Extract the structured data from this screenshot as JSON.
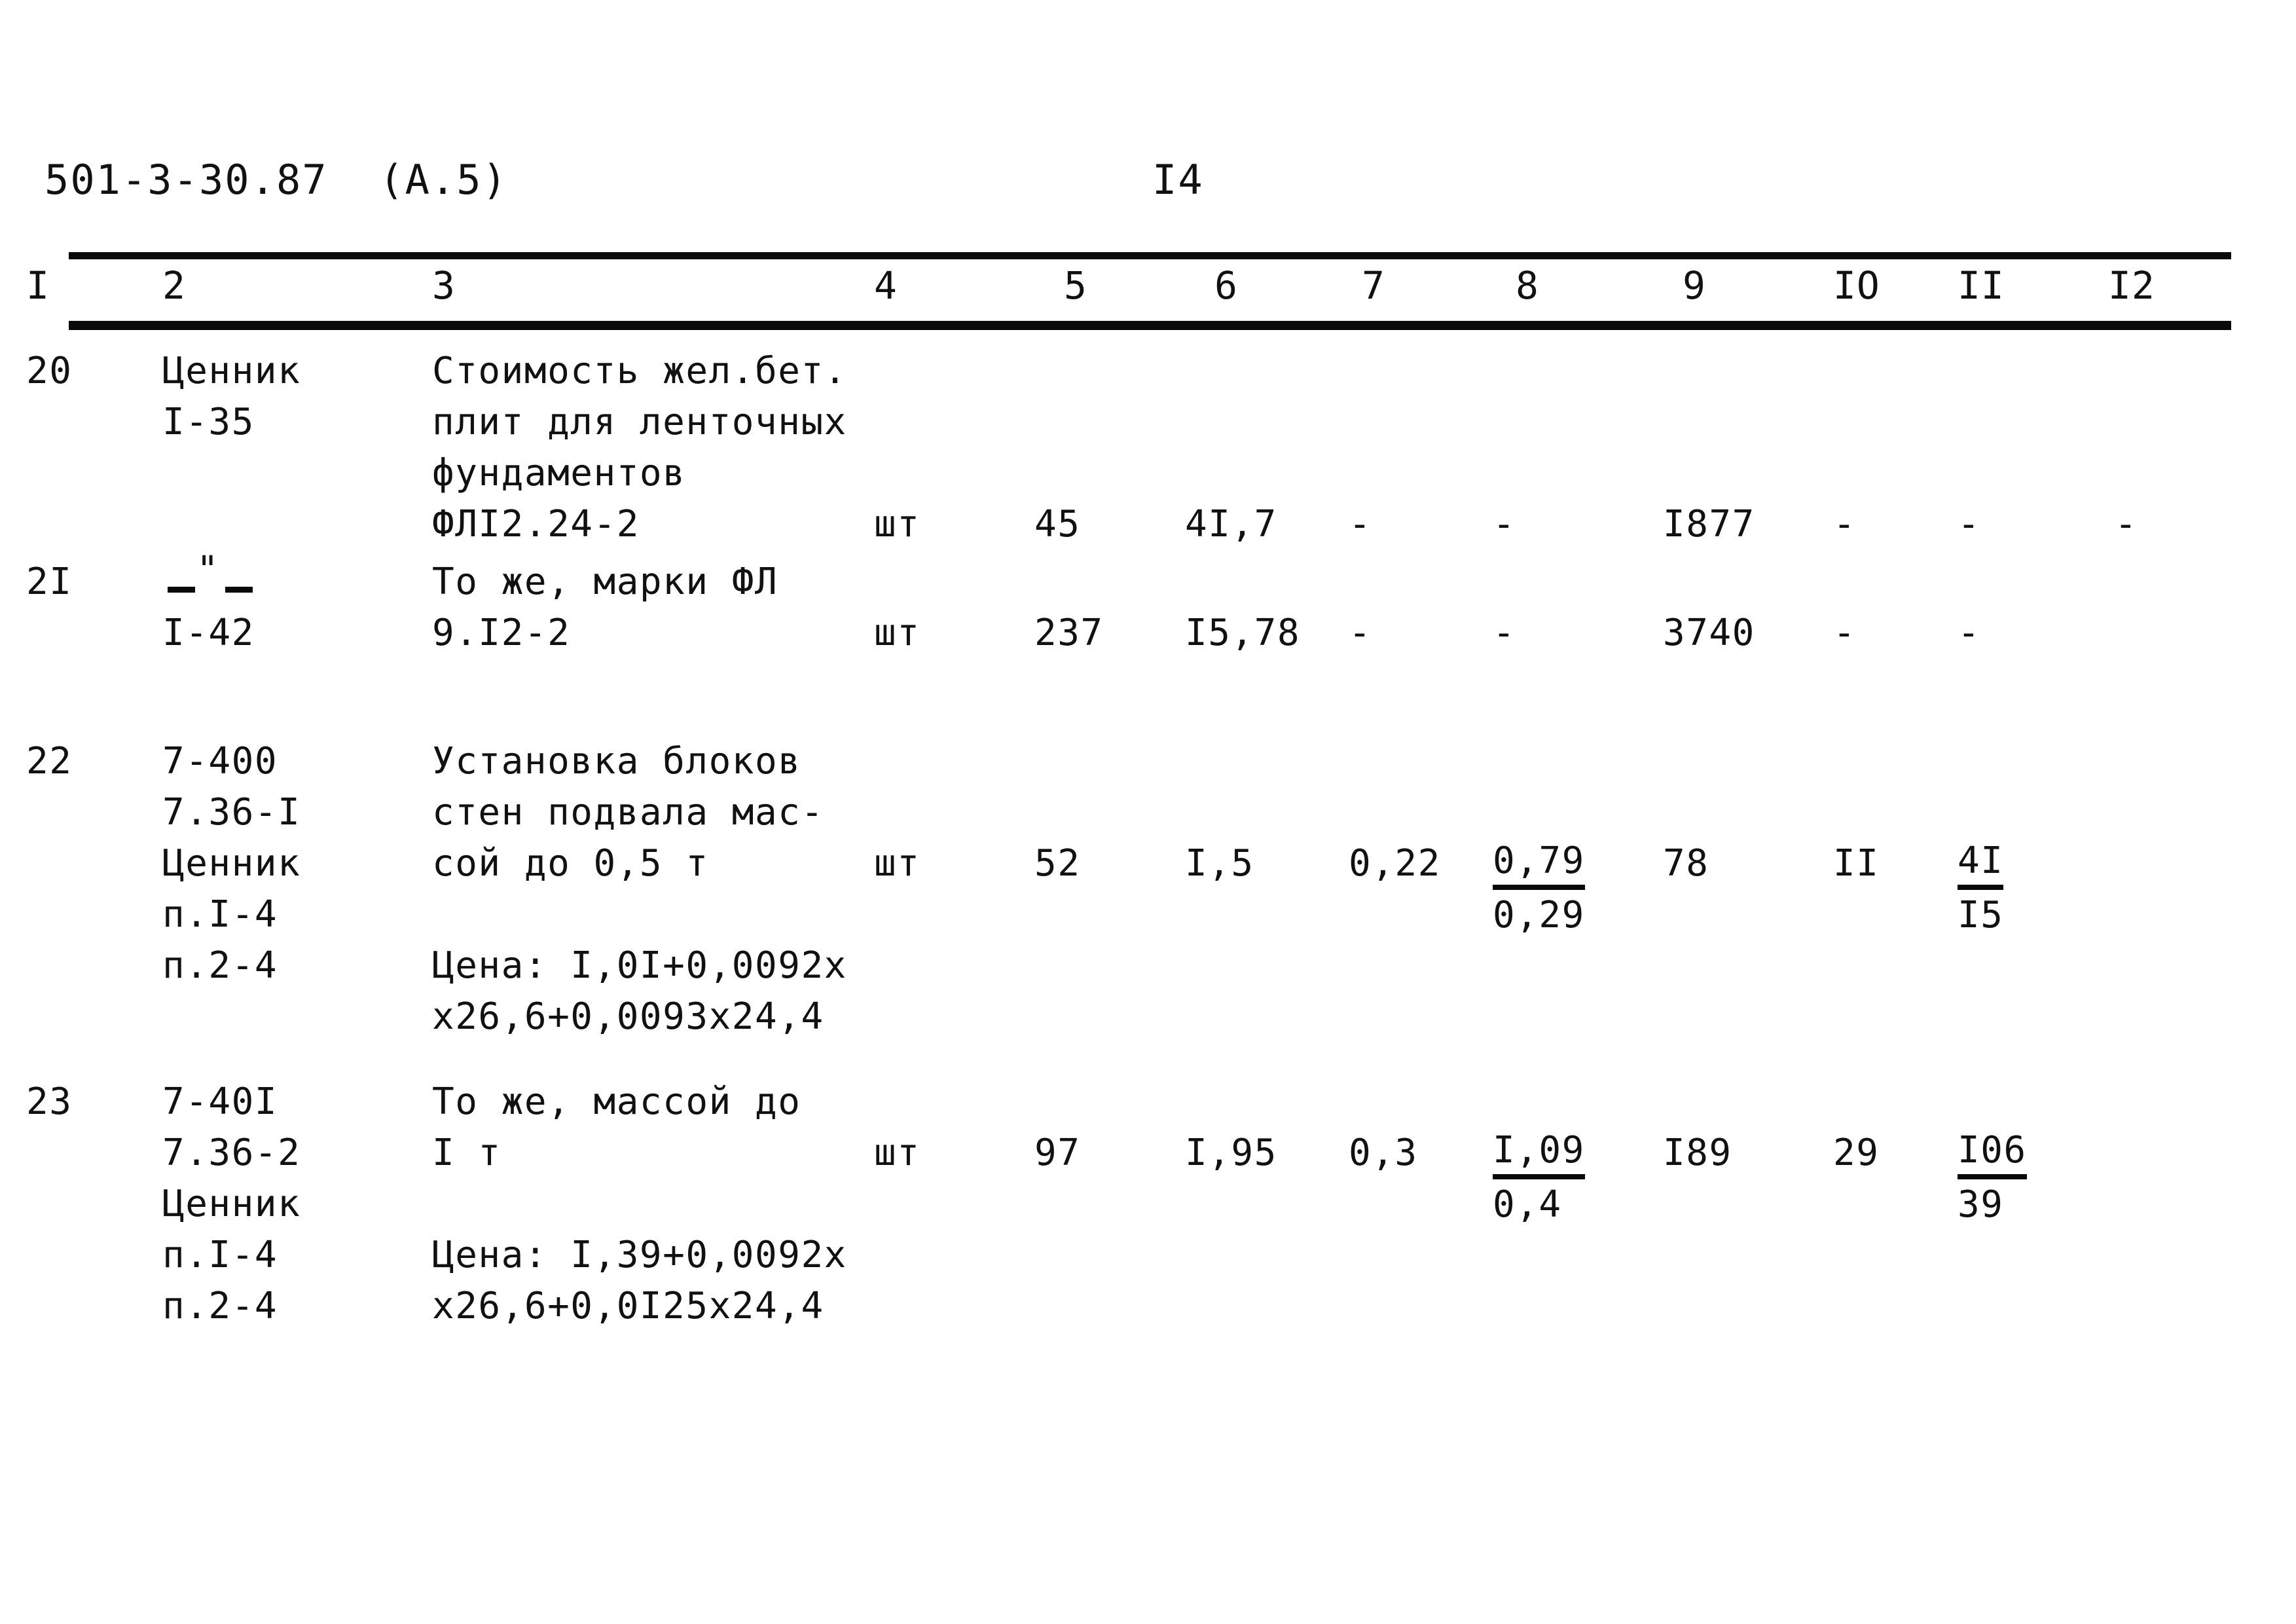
{
  "header": {
    "doc_code": "501-3-30.87",
    "doc_code_suffix": "(A.5)",
    "page_number": "I4"
  },
  "table": {
    "column_headers": [
      "I",
      "2",
      "3",
      "4",
      "5",
      "6",
      "7",
      "8",
      "9",
      "IO",
      "II",
      "I2"
    ],
    "rows": [
      {
        "num": "20",
        "code_lines": [
          "Ценник",
          "I-35"
        ],
        "desc_lines": [
          "Стоимость жел.бет.",
          "плит для ленточных",
          "фундаментов",
          "ФЛI2.24-2"
        ],
        "unit": "шт",
        "c5": "45",
        "c6": "4I,7",
        "c7": "-",
        "c8": "-",
        "c9": "I877",
        "c10": "-",
        "c11": "-",
        "c12": "-"
      },
      {
        "num": "2I",
        "code_ditto": "-\"-",
        "code_lines": [
          "I-42"
        ],
        "desc_lines": [
          "То же, марки ФЛ",
          "9.I2-2"
        ],
        "unit": "шт",
        "c5": "237",
        "c6": "I5,78",
        "c7": "-",
        "c8": "-",
        "c9": "3740",
        "c10": "-",
        "c11": "-",
        "c12": ""
      },
      {
        "num": "22",
        "code_lines": [
          "7-400",
          "7.36-I",
          "Ценник",
          "п.I-4",
          "п.2-4"
        ],
        "desc_lines": [
          "Установка блоков",
          "стен подвала мас-",
          "сой до 0,5 т",
          "",
          "Цена: I,0I+0,0092х",
          "х26,6+0,0093х24,4"
        ],
        "unit": "шт",
        "c5": "52",
        "c6": "I,5",
        "c7": "0,22",
        "c8_top": "0,79",
        "c8_bot": "0,29",
        "c9": "78",
        "c10": "II",
        "c11_top": "4I",
        "c11_bot": "I5",
        "c12": ""
      },
      {
        "num": "23",
        "code_lines": [
          "7-40I",
          "7.36-2",
          "Ценник",
          "п.I-4",
          "п.2-4"
        ],
        "desc_lines": [
          "То же, массой до",
          "I т",
          "",
          "Цена: I,39+0,0092х",
          "х26,6+0,0I25х24,4"
        ],
        "unit": "шт",
        "c5": "97",
        "c6": "I,95",
        "c7": "0,3",
        "c8_top": "I,09",
        "c8_bot": "0,4",
        "c9": "I89",
        "c10": "29",
        "c11_top": "I06",
        "c11_bot": "39",
        "c12": ""
      }
    ]
  }
}
